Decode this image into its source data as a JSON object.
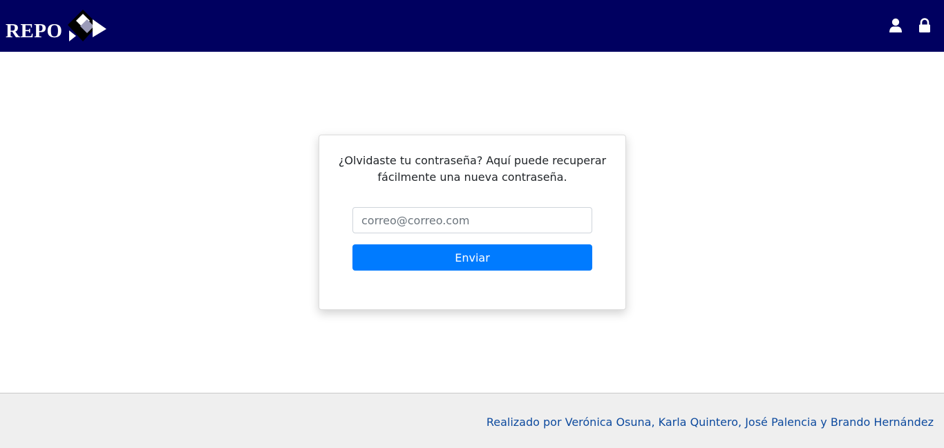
{
  "header": {
    "logo_text": "REPO",
    "icons": [
      "user-icon",
      "lock-icon"
    ],
    "background_color": "#000060"
  },
  "recovery_card": {
    "message": "¿Olvidaste tu contraseña? Aquí puede recuperar fácilmente una nueva contraseña.",
    "email_placeholder": "correo@correo.com",
    "email_value": "",
    "submit_label": "Enviar",
    "button_color": "#007bff"
  },
  "footer": {
    "credits": "Realizado por Verónica Osuna, Karla Quintero, José Palencia y Brando Hernández",
    "link_color": "#0d4a9e"
  }
}
